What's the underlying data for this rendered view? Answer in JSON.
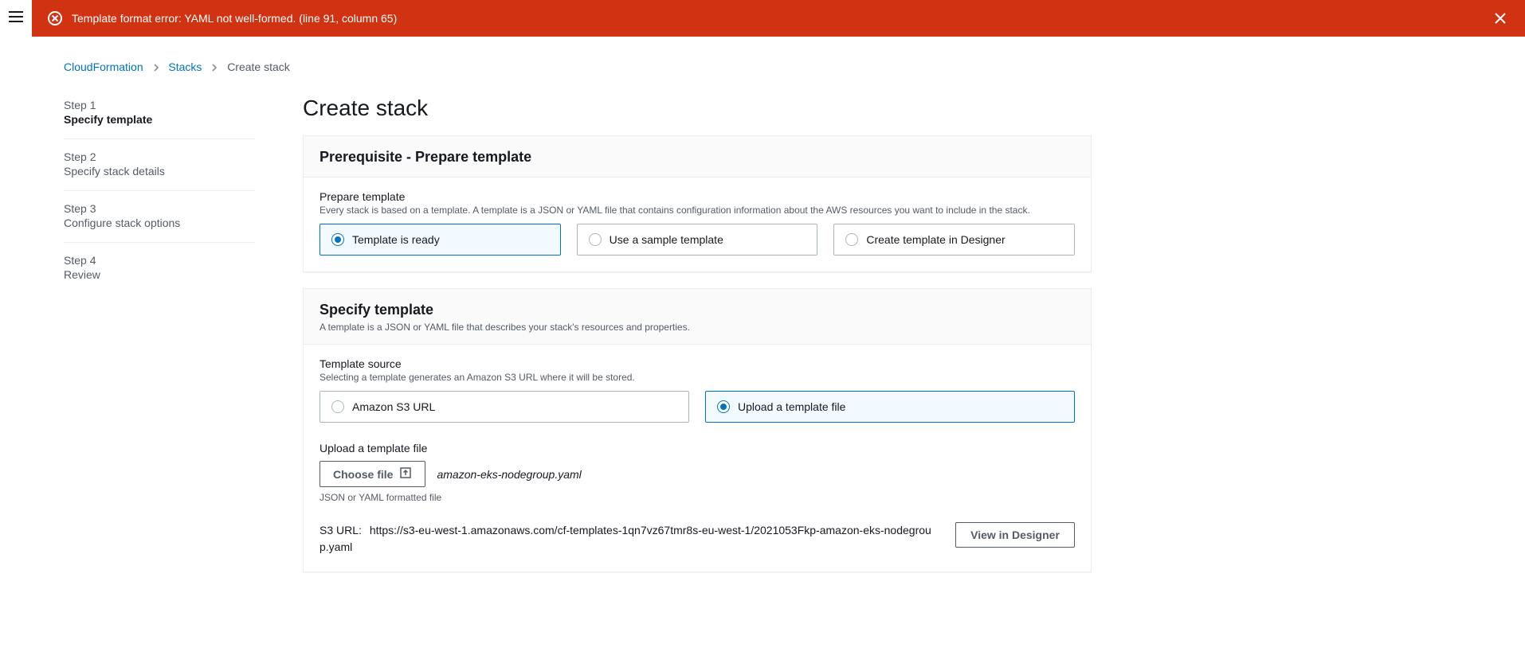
{
  "error": {
    "message": "Template format error: YAML not well-formed. (line 91, column 65)"
  },
  "breadcrumb": {
    "items": [
      "CloudFormation",
      "Stacks"
    ],
    "current": "Create stack"
  },
  "wizard": {
    "steps": [
      {
        "num": "Step 1",
        "title": "Specify template"
      },
      {
        "num": "Step 2",
        "title": "Specify stack details"
      },
      {
        "num": "Step 3",
        "title": "Configure stack options"
      },
      {
        "num": "Step 4",
        "title": "Review"
      }
    ]
  },
  "page": {
    "title": "Create stack"
  },
  "prereq": {
    "heading": "Prerequisite - Prepare template",
    "field_label": "Prepare template",
    "field_desc": "Every stack is based on a template. A template is a JSON or YAML file that contains configuration information about the AWS resources you want to include in the stack.",
    "options": {
      "ready": "Template is ready",
      "sample": "Use a sample template",
      "designer": "Create template in Designer"
    }
  },
  "specify": {
    "heading": "Specify template",
    "heading_desc": "A template is a JSON or YAML file that describes your stack's resources and properties.",
    "source_label": "Template source",
    "source_desc": "Selecting a template generates an Amazon S3 URL where it will be stored.",
    "options": {
      "s3": "Amazon S3 URL",
      "upload": "Upload a template file"
    },
    "upload_label": "Upload a template file",
    "choose_file": "Choose file",
    "filename": "amazon-eks-nodegroup.yaml",
    "hint": "JSON or YAML formatted file",
    "s3_label": "S3 URL:",
    "s3_url": "https://s3-eu-west-1.amazonaws.com/cf-templates-1qn7vz67tmr8s-eu-west-1/2021053Fkp-amazon-eks-nodegroup.yaml",
    "view_designer": "View in Designer"
  }
}
